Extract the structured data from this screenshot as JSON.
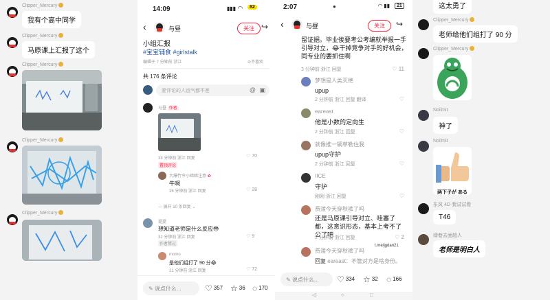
{
  "chat1": {
    "messages": [
      {
        "sender": "Clipper_Mercury",
        "text": "我有个高中同学"
      },
      {
        "sender": "Clipper_Mercury",
        "text": "马原课上汇报了这个"
      },
      {
        "sender": "Clipper_Mercury"
      },
      {
        "sender": "Clipper_Mercury"
      },
      {
        "sender": "Clipper_Mercury"
      }
    ]
  },
  "xhs1": {
    "time": "14:09",
    "battery": "82",
    "author": "与昼",
    "follow": "关注",
    "post_title": "小组汇报",
    "tags": "#宝宝辅食 #girlstalk",
    "edited": "编辑于 7 分钟前 浙江",
    "no_like": "不喜欢",
    "comment_count": "共 176 条评论",
    "comment_placeholder": "爱评论的人运气都不差",
    "comments": [
      {
        "name": "与昼",
        "badge": "作者",
        "meta": "38 分钟前 浙江 回复",
        "likes": "70",
        "tag": "置顶评论"
      },
      {
        "name": "大爆竹今小暗暗注意",
        "text": "牛啊",
        "meta": "36 分钟前 浙江 回复",
        "likes": "28"
      },
      {
        "more": "展开 10 条回复"
      },
      {
        "name": "提提",
        "text": "想知道老师是什么反应😳",
        "meta": "32 分钟前 浙江 回复",
        "likes": "9",
        "tag": "作者赞过"
      },
      {
        "name": "momo",
        "text": "是他们组打了 90 分😂",
        "meta": "21 分钟前 浙江 回复",
        "likes": "72"
      }
    ],
    "reply_placeholder": "说点什么...",
    "likes": "357",
    "stars": "36",
    "comments_total": "170"
  },
  "xhs2": {
    "time": "2:07",
    "battery": "21",
    "author": "与昼",
    "follow": "关注",
    "top_text": "留证据。毕业後要考公考编就举报一手引导对立，😂干掉竞争对手的好机会，同专业的要抓住啊",
    "top_meta": "3 分钟前 浙江 回复",
    "top_likes": "11",
    "comments": [
      {
        "name": "梦想是人类灭绝",
        "text": "upup",
        "meta": "2 分钟前 浙江 回复 翻译"
      },
      {
        "name": "eareast",
        "text": "他是小数的定向生",
        "meta": "2 分钟前 浙江 回复"
      },
      {
        "name": "就像推一辆草勒住我",
        "text": "upup守护",
        "meta": "2 分钟前 浙江 回复"
      },
      {
        "name": "IICE",
        "text": "守护",
        "meta": "刚刚 浙江 回复"
      },
      {
        "name": "费渡今天穿秋裤了吗",
        "text": "还是马原课引导对立、哇塞了都，这意识形态，基本上考不了公了吧",
        "meta": "2 分钟前 浙江 回复",
        "likes": "2"
      },
      {
        "name": "费渡今天穿秋裤了吗",
        "meta": "回复",
        "reply": "eareast：不管对方是啥身份。"
      }
    ],
    "watermark": "t.me/jgdan21",
    "reply_placeholder": "说点什么...",
    "likes": "334",
    "stars": "32",
    "comments_total": "166"
  },
  "chat2": {
    "items": [
      {
        "text": "这太勇了"
      },
      {
        "sender": "Clipper_Mercury",
        "text": "老师给他们组打了 90 分"
      },
      {
        "sender": "Clipper_Mercury"
      },
      {
        "sender": "Noilmit",
        "text": "神了"
      },
      {
        "sender": "Noilmit",
        "sticker_caption": "两下子が ある"
      },
      {
        "sender": "东风 4D·我试试看",
        "text": "T46"
      },
      {
        "sender": "绿巷去面超人",
        "text": "老师是明白人"
      }
    ]
  }
}
